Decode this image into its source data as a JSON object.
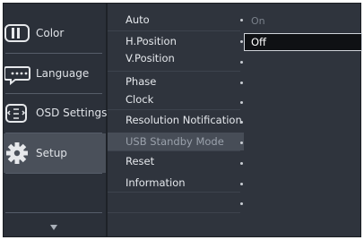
{
  "main_menu": [
    {
      "id": "color",
      "label": "Color",
      "icon": "color-icon",
      "selected": false
    },
    {
      "id": "language",
      "label": "Language",
      "icon": "speech-bubble-icon",
      "selected": false
    },
    {
      "id": "osd-settings",
      "label": "OSD Settings",
      "icon": "osd-settings-icon",
      "selected": false
    },
    {
      "id": "setup",
      "label": "Setup",
      "icon": "gear-icon",
      "selected": true
    }
  ],
  "sub_menu": [
    {
      "label": "Auto"
    },
    {
      "label": "H.Position"
    },
    {
      "label": "V.Position"
    },
    {
      "label": "Phase"
    },
    {
      "label": "Clock"
    },
    {
      "label": "Resolution Notification"
    },
    {
      "label": "USB Standby Mode",
      "selected": true
    },
    {
      "label": "Reset"
    },
    {
      "label": "Information"
    }
  ],
  "value_column": {
    "inactive_option": "On",
    "selected_option": "Off"
  },
  "scroll_indicator_icon": "triangle-down-icon",
  "colors": {
    "panel_bg": "#2f343d",
    "selected_bg": "#474d57",
    "highlight_box_bg": "#0f1114",
    "highlight_border": "#cfd3d9"
  }
}
